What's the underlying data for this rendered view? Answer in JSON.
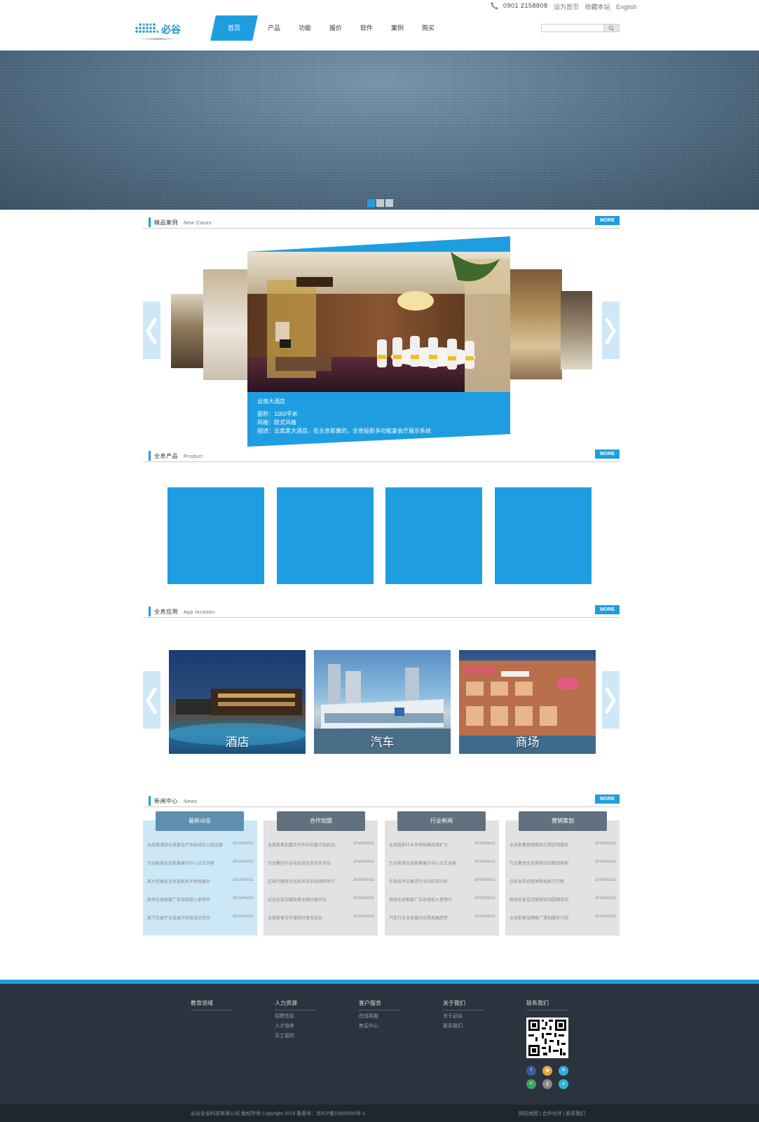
{
  "header": {
    "phone": "0901 2158808",
    "top_links": [
      "设为首页",
      "收藏本站",
      "English"
    ],
    "logo_text": "必谷",
    "nav": [
      "首页",
      "产品",
      "功能",
      "报价",
      "软件",
      "案例",
      "购买"
    ],
    "search_placeholder": ""
  },
  "sections": {
    "cases": {
      "title": "精品案例",
      "sub": "New Cases",
      "more": "MORE"
    },
    "products": {
      "title": "全息产品",
      "sub": "Product",
      "more": "MORE"
    },
    "apps": {
      "title": "全息应用",
      "sub": "App location",
      "more": "MORE"
    },
    "news": {
      "title": "新闻中心",
      "sub": "News",
      "more": "MORE"
    }
  },
  "case_main": {
    "name": "云南大酒店",
    "area": "面积：1000平米",
    "style": "风格：欧式风格",
    "desc": "描述：云南某大酒店，在全息影像的，全息投影多功能宴会厅展示系统"
  },
  "apps": [
    "酒店",
    "汽车",
    "商场"
  ],
  "news": [
    {
      "tab": "最新动态",
      "rows": [
        {
          "t": "云南某酒店全息宴会厅系统成功上线运营",
          "d": "2015/05/21"
        },
        {
          "t": "万达影城全息影像展示中心正式运营",
          "d": "2015/05/21"
        },
        {
          "t": "某大型展会全息投影技术亮相展台",
          "d": "2015/05/21"
        },
        {
          "t": "商场全息橱窗广告系统投入使用中",
          "d": "2015/05/21"
        },
        {
          "t": "某汽车展厅全息展示系统成功交付",
          "d": "2015/05/21"
        }
      ]
    },
    {
      "tab": "合作加盟",
      "rows": [
        {
          "t": "全息影像加盟合作伙伴招募计划启动",
          "d": "2015/05/21"
        },
        {
          "t": "万达集团与必谷达成全息合作协议",
          "d": "2015/05/21"
        },
        {
          "t": "区域代理商全息技术培训会顺利举行",
          "d": "2015/05/21"
        },
        {
          "t": "必谷全息加盟政策全面升级优化",
          "d": "2015/05/21"
        },
        {
          "t": "全息影像合作案例分享交流会",
          "d": "2015/05/21"
        }
      ]
    },
    {
      "tab": "行业新闻",
      "rows": [
        {
          "t": "全息投影行业市场规模持续扩大",
          "d": "2015/05/21"
        },
        {
          "t": "万达影城全息影像展示中心正式运营",
          "d": "2015/05/21"
        },
        {
          "t": "全息技术在展览行业的应用分析",
          "d": "2015/05/21"
        },
        {
          "t": "商场全息橱窗广告系统投入使用中",
          "d": "2015/05/21"
        },
        {
          "t": "汽车行业全息展示应用发展趋势",
          "d": "2015/05/21"
        }
      ]
    },
    {
      "tab": "营销策划",
      "rows": [
        {
          "t": "全息影像营销策划方案定制服务",
          "d": "2015/05/21"
        },
        {
          "t": "万达集团全息营销活动策划案例",
          "d": "2015/05/21"
        },
        {
          "t": "全息发布会整体策划执行方案",
          "d": "2015/05/21"
        },
        {
          "t": "商场全息互动营销活动圆满成功",
          "d": "2015/05/21"
        },
        {
          "t": "全息影像品牌推广策划服务介绍",
          "d": "2015/05/21"
        }
      ]
    }
  ],
  "footer": {
    "cols": [
      {
        "h": "教育领域",
        "links": []
      },
      {
        "h": "人力资源",
        "links": [
          "招聘信息",
          "人才培养",
          "员工福利"
        ]
      },
      {
        "h": "客户服务",
        "links": [
          "在线客服",
          "售后中心"
        ]
      },
      {
        "h": "关于我们",
        "links": [
          "关于必谷",
          "联系我们"
        ]
      },
      {
        "h": "联系我们",
        "links": []
      }
    ],
    "copyright": "必谷全息科技有限公司 版权所有 Copyright 2015 备案号：京ICP备15000000号-1",
    "right_links": "网站地图 | 合作伙伴 | 联系我们"
  },
  "colors": {
    "accent": "#1e9ee0",
    "footer": "#2b343e"
  }
}
